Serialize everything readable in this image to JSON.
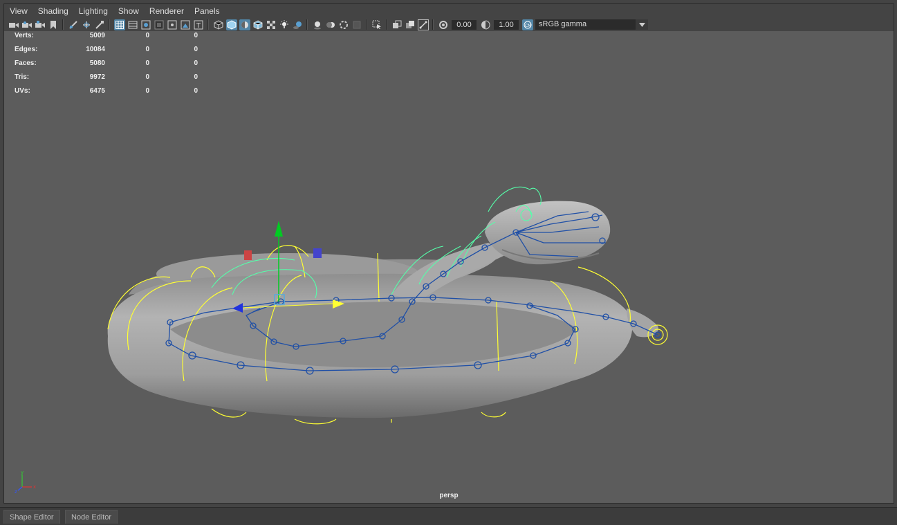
{
  "menu": [
    {
      "label": "View"
    },
    {
      "label": "Shading"
    },
    {
      "label": "Lighting"
    },
    {
      "label": "Show"
    },
    {
      "label": "Renderer"
    },
    {
      "label": "Panels"
    }
  ],
  "toolbar": {
    "exposure": "0.00",
    "gamma": "1.00",
    "color_space": "sRGB gamma",
    "icons": [
      "select-camera-icon",
      "camera-attributes-icon",
      "bookmark-icon",
      "image-plane-icon",
      "grid-icon",
      "film-gate-icon",
      "resolution-gate-icon",
      "gate-mask-icon",
      "field-chart-icon",
      "safe-action-icon",
      "safe-title-icon",
      "wireframe-icon",
      "smooth-shade-icon",
      "default-material-icon",
      "wireframe-on-shaded-icon",
      "textured-icon",
      "use-all-lights-icon",
      "shadows-icon",
      "screen-space-ao-icon",
      "motion-blur-icon",
      "anti-aliasing-icon",
      "depth-of-field-icon",
      "isolate-select-icon",
      "xray-icon",
      "xray-active-icon",
      "xray-joints-icon",
      "exposure-icon",
      "gamma-icon",
      "color-management-icon"
    ]
  },
  "hud": {
    "rows": [
      {
        "label": "Verts:",
        "v1": "5009",
        "v2": "0",
        "v3": "0"
      },
      {
        "label": "Edges:",
        "v1": "10084",
        "v2": "0",
        "v3": "0"
      },
      {
        "label": "Faces:",
        "v1": "5080",
        "v2": "0",
        "v3": "0"
      },
      {
        "label": "Tris:",
        "v1": "9972",
        "v2": "0",
        "v3": "0"
      },
      {
        "label": "UVs:",
        "v1": "6475",
        "v2": "0",
        "v3": "0"
      }
    ]
  },
  "viewport": {
    "camera": "persp",
    "axis_labels": {
      "x": "x",
      "y": "y",
      "z": "z"
    },
    "colors": {
      "background": "#5c5c5c",
      "mesh": "#a8a8a8",
      "joints": "#1f4fa6",
      "yellow_controls": "#ffff33",
      "green_controls": "#55ffaa",
      "manipulator_y": "#00cc22",
      "manipulator_x": "#dd2222",
      "manipulator_z": "#2233dd"
    }
  },
  "bottom_tabs": [
    {
      "label": "Shape Editor"
    },
    {
      "label": "Node Editor"
    }
  ]
}
